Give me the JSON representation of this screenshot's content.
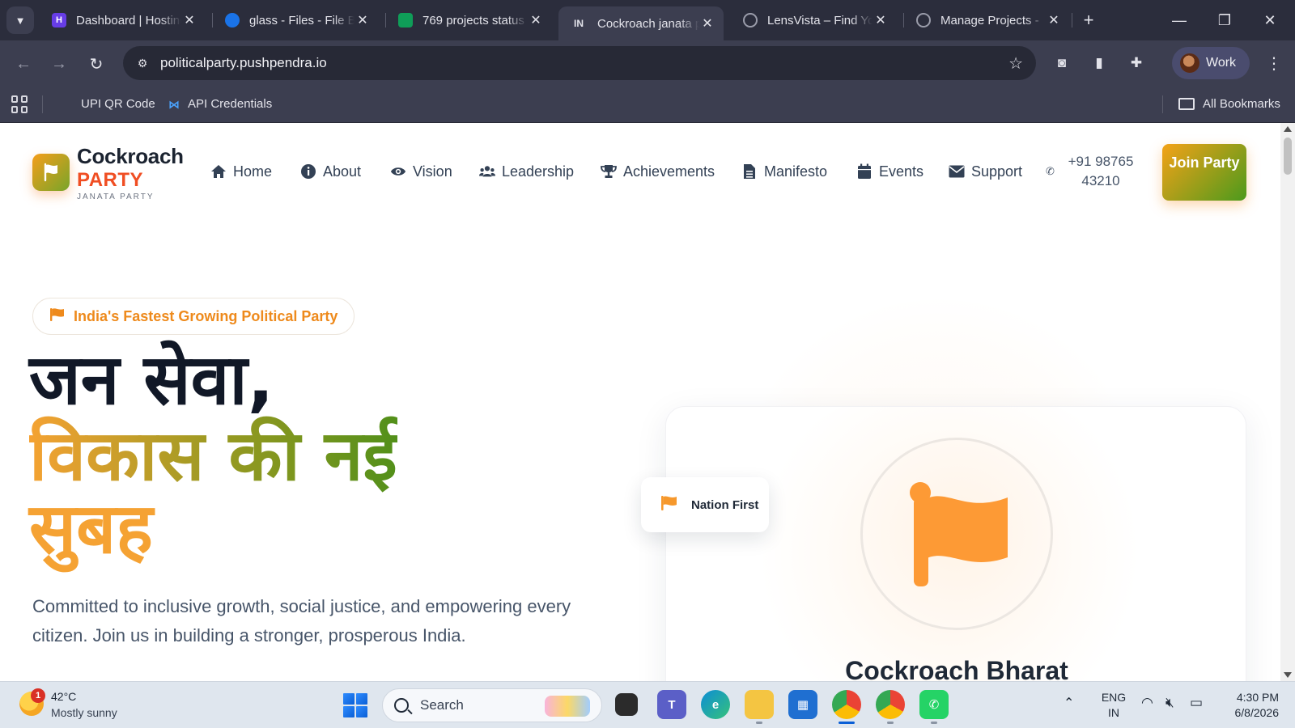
{
  "browser": {
    "tabs": [
      {
        "title": "Dashboard | Hostinger",
        "favicon": "hostinger-logo",
        "fav_color": "#673de6",
        "fav_text": "H",
        "active": false
      },
      {
        "title": "glass - Files - File Browser",
        "favicon": "globe-blue",
        "fav_color": "#1a73e8",
        "fav_text": "",
        "active": false
      },
      {
        "title": "769 projects status",
        "favicon": "sheets",
        "fav_color": "#0f9d58",
        "fav_text": "",
        "active": false
      },
      {
        "title": "Cockroach janata party",
        "favicon": "IN",
        "fav_color": "",
        "fav_text": "IN",
        "active": true
      },
      {
        "title": "LensVista – Find Your",
        "favicon": "globe",
        "fav_color": "",
        "fav_text": "",
        "active": false
      },
      {
        "title": "Manage Projects - ",
        "favicon": "globe",
        "fav_color": "",
        "fav_text": "",
        "active": false
      }
    ],
    "url": "politicalparty.pushpendra.io",
    "profile_label": "Work",
    "bookmarks": [
      {
        "label": "UPI QR Code"
      },
      {
        "label": "API Credentials"
      }
    ],
    "all_bookmarks_label": "All Bookmarks"
  },
  "site": {
    "brand": {
      "name": "Cockroach",
      "party": "PARTY",
      "subtitle": "JANATA PARTY"
    },
    "nav": [
      {
        "label": "Home",
        "icon": "home-icon"
      },
      {
        "label": "About",
        "icon": "info-icon"
      },
      {
        "label": "Vision",
        "icon": "eye-icon"
      },
      {
        "label": "Leadership",
        "icon": "users-icon"
      },
      {
        "label": "Achievements",
        "icon": "trophy-icon"
      },
      {
        "label": "Manifesto",
        "icon": "document-icon"
      },
      {
        "label": "Events",
        "icon": "calendar-icon"
      },
      {
        "label": "Support",
        "icon": "envelope-icon"
      }
    ],
    "phone": "+91 98765 43210",
    "join_button": "Join Party",
    "hero": {
      "badge": "India's Fastest Growing Political Party",
      "line1": "जन सेवा,",
      "line2": "विकास की नई",
      "line3": "सुबह",
      "description": "Committed to inclusive growth, social justice, and empowering every citizen. Join us in building a stronger, prosperous India.",
      "floating_badge": "Nation First",
      "card_title": "Cockroach Bharat"
    },
    "colors": {
      "accent_orange": "#f5a233",
      "accent_green": "#52901a",
      "party_red": "#f04e23"
    }
  },
  "taskbar": {
    "weather": {
      "temp": "42°C",
      "desc": "Mostly sunny",
      "badge": "1"
    },
    "search_placeholder": "Search",
    "lang_line1": "ENG",
    "lang_line2": "IN",
    "time": "4:30 PM",
    "date": "6/8/2026"
  }
}
